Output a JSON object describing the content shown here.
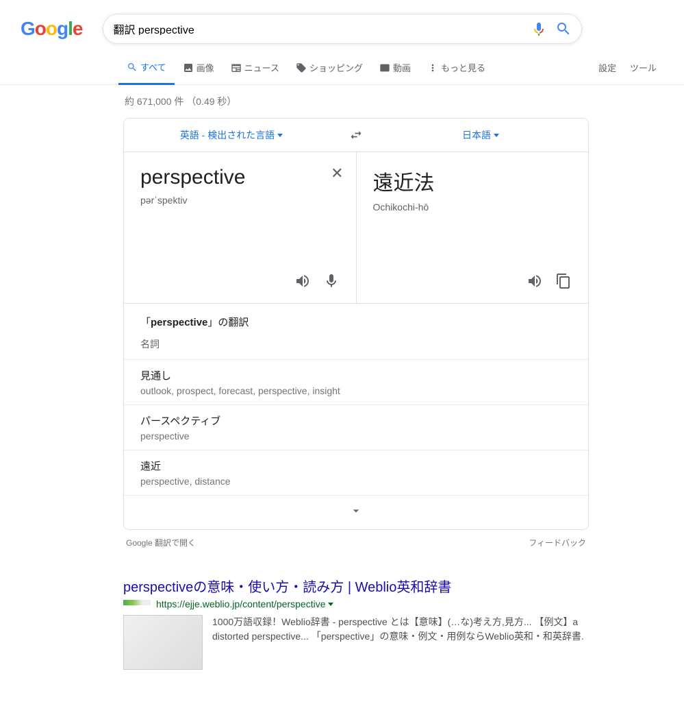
{
  "search": {
    "query": "翻訳 perspective"
  },
  "tabs": {
    "all": "すべて",
    "images": "画像",
    "news": "ニュース",
    "shopping": "ショッピング",
    "videos": "動画",
    "more": "もっと見る",
    "settings": "設定",
    "tools": "ツール"
  },
  "stats": "約 671,000 件 （0.49 秒）",
  "translate": {
    "srcLang": "英語 - 検出された言語",
    "dstLang": "日本語",
    "srcWord": "perspective",
    "srcPron": "pərˈspektiv",
    "dstWord": "遠近法",
    "dstPron": "Ochikochi-hō",
    "defHead": "「perspective」の翻訳",
    "pos": "名詞",
    "defs": [
      {
        "term": "見通し",
        "syn": "outlook, prospect, forecast, perspective, insight"
      },
      {
        "term": "パースペクティブ",
        "syn": "perspective"
      },
      {
        "term": "遠近",
        "syn": "perspective, distance"
      }
    ]
  },
  "footer": {
    "open": "Google 翻訳で開く",
    "feedback": "フィードバック"
  },
  "result": {
    "title": "perspectiveの意味・使い方・読み方 | Weblio英和辞書",
    "url": "https://ejje.weblio.jp/content/perspective",
    "desc1": "1000万語収録！Weblio辞書 - perspective とは【意味】(…な)考え方,見方... 【例文】a distorted perspective... 「perspective」の意味・例文・用例ならWeblio英和・和英辞書."
  }
}
